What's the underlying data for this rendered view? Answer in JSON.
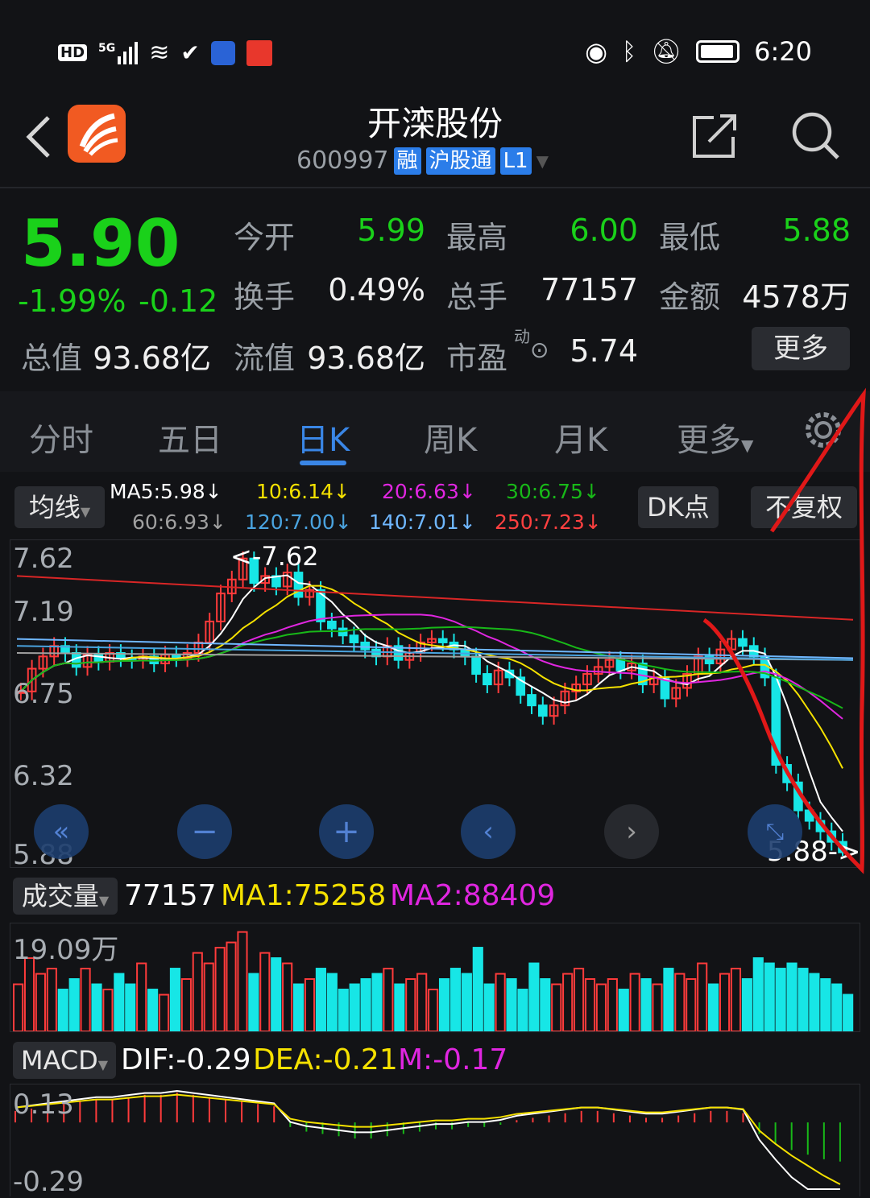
{
  "status_bar": {
    "left_icons": [
      "hd-icon",
      "5g-signal-icon",
      "wifi-icon",
      "link-icon",
      "app-notification-icon",
      "red-envelope-icon"
    ],
    "hd": "HD",
    "net": "5G",
    "right_icons": [
      "eye-icon",
      "bluetooth-icon",
      "mute-bell-icon",
      "battery-icon"
    ],
    "time": "6:20"
  },
  "header": {
    "title": "开滦股份",
    "code": "600997",
    "tags": [
      "融",
      "沪股通",
      "L1"
    ]
  },
  "quote": {
    "price": "5.90",
    "change_pct": "-1.99%",
    "change": "-0.12",
    "open_label": "今开",
    "open": "5.99",
    "high_label": "最高",
    "high": "6.00",
    "low_label": "最低",
    "low": "5.88",
    "turnover_label": "换手",
    "turnover": "0.49%",
    "volume_label": "总手",
    "volume": "77157",
    "amount_label": "金额",
    "amount": "4578万",
    "mktcap_label": "总值",
    "mktcap": "93.68亿",
    "float_label": "流值",
    "float": "93.68亿",
    "pe_label": "市盈",
    "pe_sup": "动",
    "pe": "5.74",
    "more_label": "更多"
  },
  "tabs": {
    "items": [
      "分时",
      "五日",
      "日K",
      "周K",
      "月K",
      "更多"
    ],
    "active": "日K"
  },
  "ma_bar": {
    "selector": "均线",
    "ma5": "MA5:5.98↓",
    "ma10": "10:6.14↓",
    "ma20": "20:6.63↓",
    "ma30": "30:6.75↓",
    "ma60": "60:6.93↓",
    "ma120": "120:7.00↓",
    "ma140": "140:7.01↓",
    "ma250": "250:7.23↓",
    "dk_button": "DK点",
    "adjust_button": "不复权"
  },
  "colors": {
    "up": "#ff3b3b",
    "down": "#17e6e6",
    "ma5": "#ffffff",
    "ma10": "#f5e100",
    "ma20": "#e026e0",
    "ma30": "#18b818",
    "ma60": "#a0a0a0",
    "ma120": "#4aa3df",
    "ma140": "#6fb7ff",
    "ma250": "#d92626",
    "accent": "#3a86e6"
  },
  "kline": {
    "price_ticks": [
      "7.62",
      "7.19",
      "6.75",
      "6.32",
      "5.88"
    ],
    "high_marker": "<-7.62",
    "low_marker": "5.88->"
  },
  "chart_nav_icons": [
    "rewind-icon",
    "zoom-out-icon",
    "zoom-in-icon",
    "prev-icon",
    "next-icon",
    "expand-icon"
  ],
  "volume": {
    "selector": "成交量",
    "value": "77157",
    "ma1": "MA1:75258",
    "ma2": "MA2:88409",
    "max_label": "19.09万"
  },
  "macd": {
    "selector": "MACD",
    "dif": "DIF:-0.29",
    "dea": "DEA:-0.21",
    "m": "M:-0.17",
    "top_label": "0.13",
    "bottom_label": "-0.29"
  },
  "chart_data": [
    {
      "type": "candlestick",
      "ylim": [
        5.88,
        7.62
      ],
      "y_ticks": [
        7.62,
        7.19,
        6.75,
        6.32,
        5.88
      ],
      "closes": [
        6.82,
        6.95,
        7.02,
        7.08,
        7.04,
        6.96,
        7.03,
        6.99,
        7.04,
        7.01,
        7.0,
        7.02,
        6.98,
        7.03,
        7.01,
        7.04,
        7.1,
        7.22,
        7.38,
        7.46,
        7.58,
        7.44,
        7.48,
        7.42,
        7.5,
        7.36,
        7.4,
        7.22,
        7.18,
        7.14,
        7.1,
        7.06,
        7.02,
        7.08,
        7.0,
        7.04,
        7.1,
        7.12,
        7.1,
        7.06,
        7.02,
        6.92,
        6.86,
        6.94,
        6.9,
        6.8,
        6.74,
        6.68,
        6.74,
        6.82,
        6.86,
        6.92,
        6.96,
        7.0,
        6.94,
        6.98,
        6.86,
        6.9,
        6.78,
        6.84,
        6.92,
        7.02,
        6.98,
        7.06,
        7.12,
        7.08,
        7.02,
        6.9,
        6.4,
        6.3,
        6.14,
        6.08,
        6.02,
        5.96,
        5.9
      ]
    },
    {
      "type": "bar",
      "name": "volume",
      "ylim": [
        0,
        19.09
      ],
      "values": [
        9,
        14,
        11,
        12,
        8,
        10,
        12,
        9,
        8,
        11,
        9,
        13,
        8,
        7,
        12,
        10,
        15,
        13,
        16,
        17,
        19,
        11,
        15,
        14,
        13,
        9,
        10,
        12,
        11,
        8,
        9,
        10,
        11,
        12,
        9,
        10,
        11,
        8,
        10,
        12,
        11,
        16,
        9,
        11,
        10,
        8,
        13,
        10,
        9,
        11,
        12,
        10,
        9,
        10,
        8,
        11,
        10,
        9,
        12,
        11,
        10,
        13,
        9,
        11,
        12,
        10,
        14,
        13,
        12,
        13,
        12,
        11,
        10,
        9,
        7
      ]
    },
    {
      "type": "bar",
      "name": "MACD",
      "ylim": [
        -0.29,
        0.13
      ],
      "values": [
        0.05,
        0.06,
        0.07,
        0.08,
        0.09,
        0.1,
        0.1,
        0.11,
        0.12,
        0.12,
        0.13,
        0.12,
        0.11,
        0.1,
        0.09,
        0.08,
        0.07,
        -0.02,
        -0.04,
        -0.05,
        -0.06,
        -0.07,
        -0.07,
        -0.06,
        -0.05,
        -0.04,
        -0.03,
        -0.03,
        -0.02,
        -0.02,
        -0.01,
        0.01,
        0.02,
        0.03,
        0.04,
        0.05,
        0.05,
        0.04,
        0.03,
        0.02,
        0.02,
        0.03,
        0.04,
        0.05,
        0.05,
        0.04,
        -0.05,
        -0.09,
        -0.12,
        -0.14,
        -0.16,
        -0.17
      ]
    }
  ]
}
